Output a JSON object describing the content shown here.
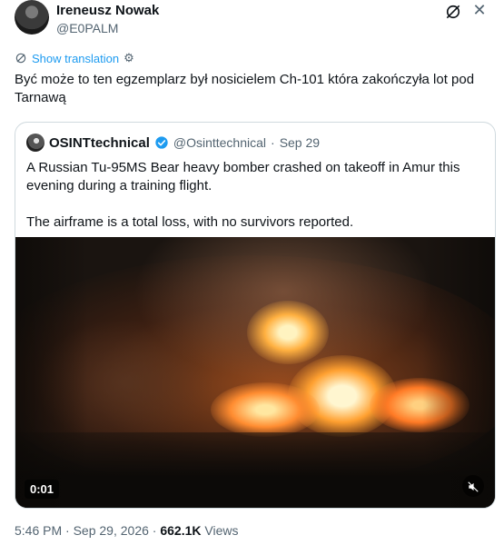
{
  "tweet": {
    "author_name": "Ireneusz Nowak",
    "author_handle": "@E0PALM",
    "translate_label": "Show translation",
    "text": "Być może to ten egzemplarz był nosicielem Ch-101 która zakończyła lot pod Tarnawą",
    "icons": {
      "avatar": "avatar",
      "grok": "grok-icon",
      "more": "more-icon",
      "settings": "gear-icon"
    }
  },
  "quote": {
    "author_name": "OSINTtechnical",
    "author_handle": "@Osinttechnical",
    "separator": "·",
    "date": "Sep 29",
    "paragraphs": [
      "A Russian Tu-95MS Bear heavy bomber crashed on takeoff in Amur this evening during a training flight.",
      "The airframe is a total loss, with no survivors reported."
    ],
    "video": {
      "timestamp": "0:01",
      "icons": {
        "mute": "mute-icon"
      }
    },
    "verified_color": "#1d9bf0"
  },
  "footer": {
    "time": "5:46 PM",
    "separator": "·",
    "date": "Sep 29, 2026",
    "separator2": "·",
    "views_count": "662.1K",
    "views_label": "Views"
  },
  "colors": {
    "accent": "#1d9bf0",
    "text": "#0f1419",
    "muted": "#536471",
    "border": "#cfd9de"
  }
}
